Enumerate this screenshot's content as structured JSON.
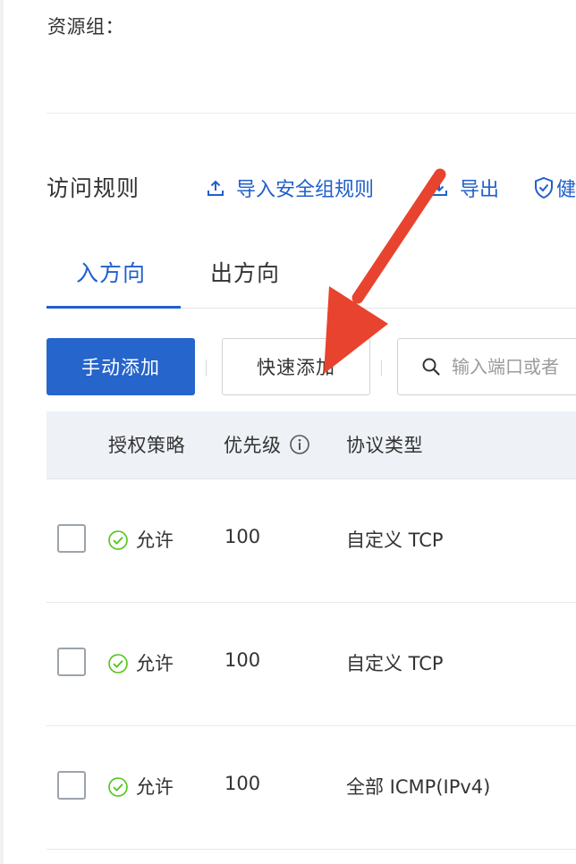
{
  "resource_group": {
    "label": "资源组："
  },
  "rules": {
    "title": "访问规则",
    "actions": {
      "import": "导入安全组规则",
      "export": "导出",
      "health": "健"
    }
  },
  "tabs": [
    {
      "label": "入方向",
      "active": true
    },
    {
      "label": "出方向",
      "active": false
    }
  ],
  "toolbar": {
    "manual_add": "手动添加",
    "quick_add": "快速添加",
    "search_placeholder": "输入端口或者"
  },
  "table": {
    "headers": {
      "policy": "授权策略",
      "priority": "优先级",
      "protocol": "协议类型"
    },
    "rows": [
      {
        "policy": "允许",
        "priority": "100",
        "protocol": "自定义 TCP"
      },
      {
        "policy": "允许",
        "priority": "100",
        "protocol": "自定义 TCP"
      },
      {
        "policy": "允许",
        "priority": "100",
        "protocol": "全部 ICMP(IPv4)"
      }
    ]
  },
  "colors": {
    "accent": "#2160cc",
    "primary_button": "#2565cc",
    "success": "#52c41a",
    "annotation_arrow": "#e8432e"
  }
}
